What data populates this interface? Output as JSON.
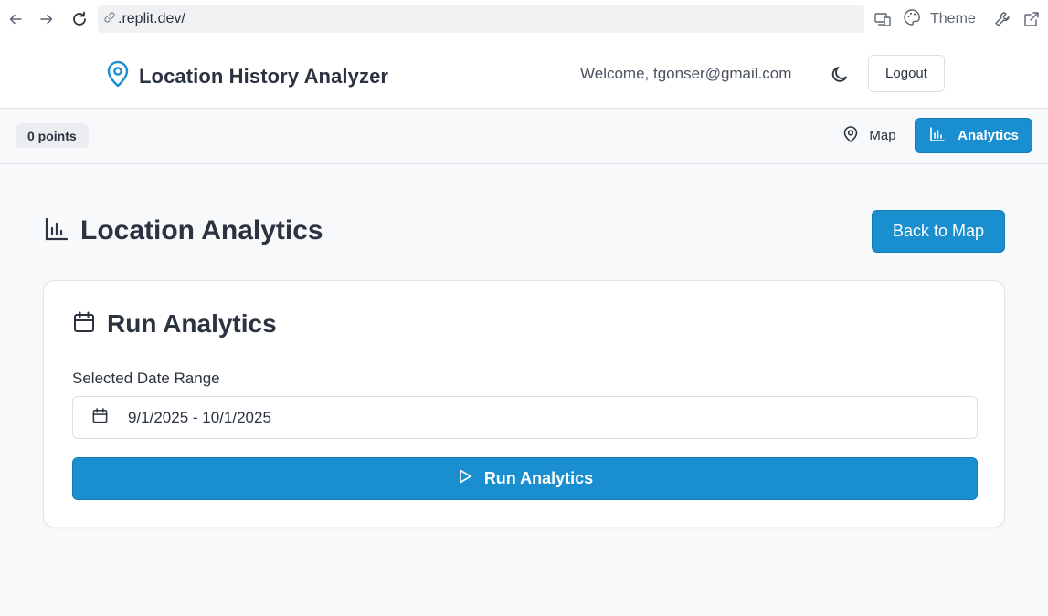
{
  "browser": {
    "url": ".replit.dev/",
    "theme_label": "Theme",
    "icons": [
      "back-arrow-icon",
      "forward-arrow-icon",
      "reload-icon",
      "link-icon",
      "devices-icon",
      "palette-icon",
      "wrench-icon",
      "external-link-icon"
    ]
  },
  "header": {
    "app_title": "Location History Analyzer",
    "welcome": "Welcome, tgonser@gmail.com",
    "logout_label": "Logout",
    "accent_color": "#1a8fd0"
  },
  "toolbar": {
    "points_badge": "0 points",
    "tabs": [
      {
        "label": "Map",
        "icon": "map-pin-icon",
        "active": false
      },
      {
        "label": "Analytics",
        "icon": "bar-chart-icon",
        "active": true
      }
    ]
  },
  "main": {
    "page_title": "Location Analytics",
    "back_button_label": "Back to Map",
    "card": {
      "title": "Run Analytics",
      "date_range_label": "Selected Date Range",
      "date_range_value": "9/1/2025 - 10/1/2025",
      "run_button_label": "Run Analytics"
    }
  }
}
